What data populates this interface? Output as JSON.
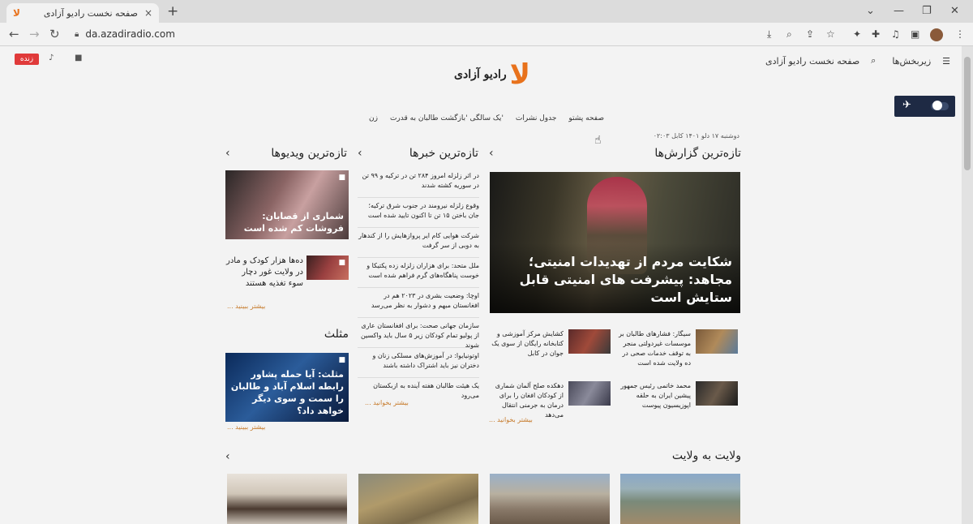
{
  "browser": {
    "tab_title": "صفحه نخست رادیو آزادی",
    "tab_close": "×",
    "new_tab": "+",
    "url": "da.azadiradio.com",
    "controls": {
      "minimize": "—",
      "maximize": "❐",
      "close": "✕",
      "chevron": "⌄"
    },
    "nav": {
      "back": "←",
      "forward": "→",
      "reload": "↻"
    },
    "toolbar_icons": {
      "install": "⤓",
      "zoom": "⌕",
      "share": "⇪",
      "bookmark": "☆",
      "extension": "✦",
      "puzzle": "✚",
      "media": "♫",
      "sidepanel": "▣",
      "menu": "⋮"
    }
  },
  "header": {
    "live_label": "زنده",
    "audio_icon": "♪",
    "video_icon": "■",
    "menu_label": "زیربخش‌ها",
    "menu_icon": "☰",
    "search_icon": "⌕",
    "home_link": "صفحه نخست رادیو آزادی",
    "logo_text": "رادیو آزادی",
    "logo_mark": "ﻻ"
  },
  "nav": {
    "items": [
      "صفحه پشتو",
      "جدول نشرات",
      "یک سالگی 'بازگشت طالبان به قدرت'",
      "زن"
    ]
  },
  "date_line": "دوشنبه ۱۷ دلو ۱۴۰۱ کابل ۰۲:۰۳",
  "reports": {
    "title": "تازه‌ترین گزارش‌ها",
    "arrow": "‹",
    "hero_headline": "شکایت مردم از تهدیدات امنیتی؛ مجاهد: پیشرفت های امنیتی قابل ستایش است",
    "items": [
      "سیگار: فشارهای طالبان بر موسسات غیردولتی منجر به توقف خدمات صحی در ده ولایت شده است",
      "کشایش مرکز آموزشی و کتابخانه رایگان از سوی یک جوان در کابل",
      "محمد خاتمی رئیس جمهور پیشین ایران به حلقه اپوزیسیون پیوست",
      "دهکده صلح آلمان شماری از کودکان افغان را برای درمان به جرمنی انتقال می‌دهد"
    ],
    "more": "بیشتر بخوانید ..."
  },
  "news": {
    "title": "تازه‌ترین خبرها",
    "arrow": "‹",
    "items": [
      "در اثر زلزله امروز ۲۸۴ تن در ترکیه و ۹۹ تن در سوریه کشته شدند",
      "وقوع زلزله نیرومند در جنوب شرق ترکیه؛ جان باختن ۱۵ تن تا اکنون تایید شده است",
      "شرکت هوایی کام ایر پروازهایش را از کندهار به دوبی از سر گرفت",
      "ملل متحد: برای هزاران زلزله زده پکتیکا و خوست پناهگاه‌های گرم فراهم شده است",
      "اوچا: وضعیت بشری در ۲۰۲۳ هم در افغانستان مبهم و دشوار به نظر می‌رسد",
      "سازمان جهانی صحت: برای افغانستان عاری از پولیو تمام کودکان زیر ۵ سال باید واکسین شوند",
      "اوتونیایوا: در آموزش‌های مسلکی زنان و دختران نیز باید اشتراک داشته باشند",
      "یک هیئت طالبان هفته آینده به ازبکستان می‌رود"
    ],
    "more": "بیشتر بخوانید ..."
  },
  "videos": {
    "title": "تازه‌ترین ویدیوها",
    "arrow": "‹",
    "big_caption": "شماری از قصابان: فروشات کم شده است",
    "small_caption": "ده‌ها هزار کودک و مادر در ولایت غور دچار سوء تغذیه هستند",
    "more": "بیشتر ببینید ..."
  },
  "mosalas": {
    "title": "مثلث",
    "caption": "مثلث: آیا حمله پشاور رابطه اسلام آباد و طالبان را سمت و سوی دیگر خواهد داد؟",
    "more": "بیشتر ببینید ..."
  },
  "provinces": {
    "title": "ولایت به ولایت",
    "arrow": "‹"
  },
  "icons": {
    "camera": "■",
    "plane": "✈"
  }
}
